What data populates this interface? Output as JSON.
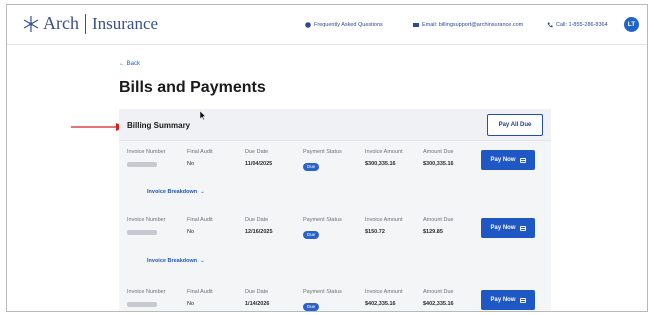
{
  "header": {
    "logo_arch": "Arch",
    "logo_insurance": "Insurance",
    "faq": "Frequently Asked Questions",
    "email": "Email: billingsupport@archinsurance.com",
    "call": "Call: 1-855-286-8364",
    "avatar_initials": "LT"
  },
  "nav": {
    "back": "← Back"
  },
  "page": {
    "title": "Bills and Payments"
  },
  "billing": {
    "title": "Billing Summary",
    "pay_all_label": "Pay All Due",
    "columns": {
      "invoice_number": "Invoice Number",
      "final_audit": "Final Audit",
      "due_date": "Due Date",
      "payment_status": "Payment Status",
      "invoice_amount": "Invoice Amount",
      "amount_due": "Amount Due"
    },
    "pay_now_label": "Pay Now",
    "breakdown_label": "Invoice Breakdown",
    "invoices": [
      {
        "final_audit": "No",
        "due_date": "11/04/2025",
        "status": "Due",
        "invoice_amount": "$300,335.16",
        "amount_due": "$300,335.16"
      },
      {
        "final_audit": "No",
        "due_date": "12/16/2025",
        "status": "Due",
        "invoice_amount": "$150.72",
        "amount_due": "$129.85"
      },
      {
        "final_audit": "No",
        "due_date": "1/14/2026",
        "status": "Due",
        "invoice_amount": "$402,335.16",
        "amount_due": "$402,335.16"
      }
    ]
  },
  "colors": {
    "accent": "#1f57c4",
    "annotation_arrow": "#d42020",
    "brand": "#3a4f8f"
  }
}
